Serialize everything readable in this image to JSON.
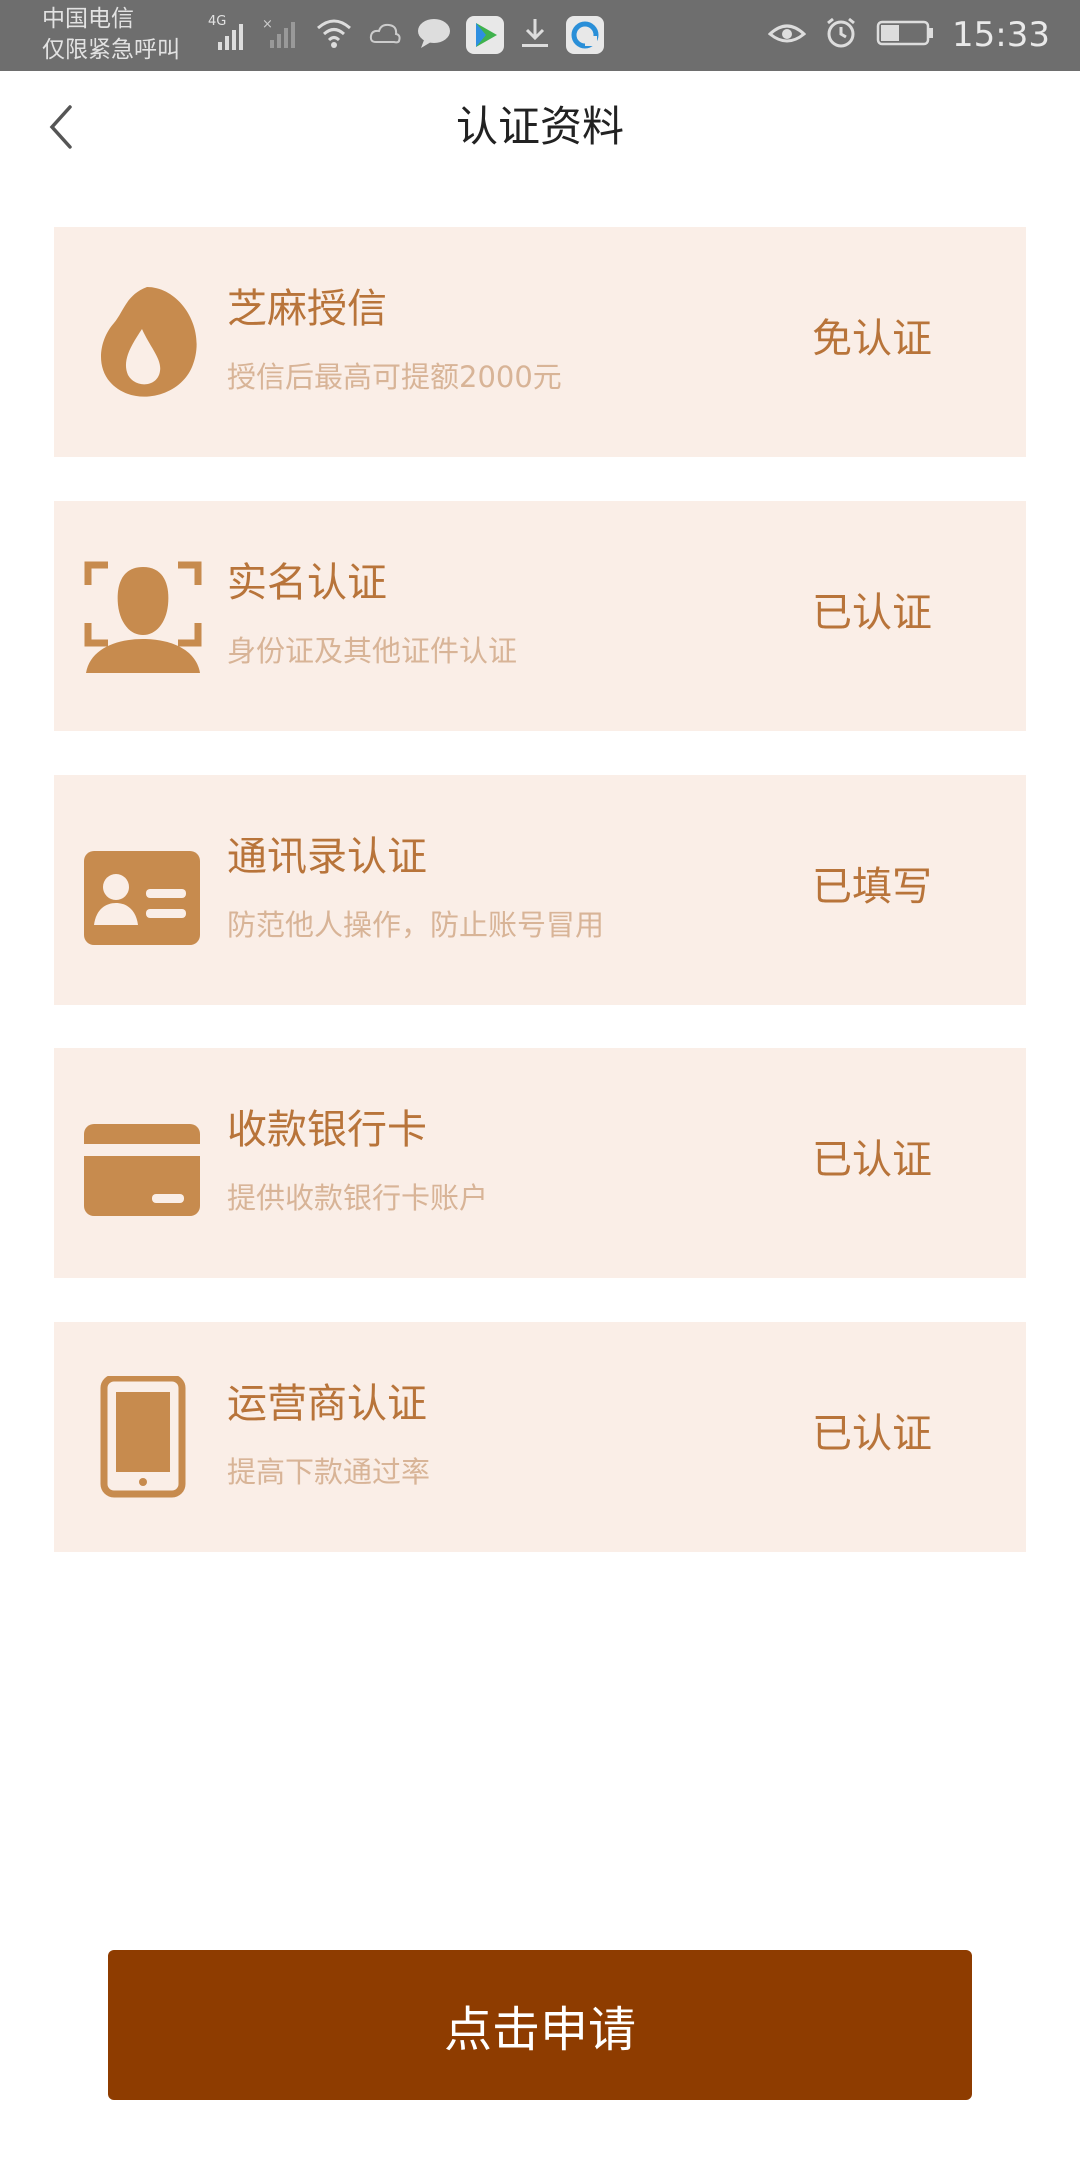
{
  "statusbar": {
    "carrier_line1": "中国电信",
    "carrier_line2": "仅限紧急呼叫",
    "network": "4G",
    "time": "15:33"
  },
  "header": {
    "title": "认证资料"
  },
  "cards": [
    {
      "title": "芝麻授信",
      "subtitle": "授信后最高可提额2000元",
      "status": "免认证",
      "icon": "sesame-credit-icon"
    },
    {
      "title": "实名认证",
      "subtitle": "身份证及其他证件认证",
      "status": "已认证",
      "icon": "face-recognition-icon"
    },
    {
      "title": "通讯录认证",
      "subtitle": "防范他人操作，防止账号冒用",
      "status": "已填写",
      "icon": "contact-card-icon"
    },
    {
      "title": "收款银行卡",
      "subtitle": "提供收款银行卡账户",
      "status": "已认证",
      "icon": "bank-card-icon"
    },
    {
      "title": "运营商认证",
      "subtitle": "提高下款通过率",
      "status": "已认证",
      "icon": "phone-icon"
    }
  ],
  "apply_button": "点击申请",
  "colors": {
    "accent": "#b8743a",
    "card_bg": "#faeee7",
    "subtitle": "#d8b497",
    "button": "#8e3c00"
  }
}
